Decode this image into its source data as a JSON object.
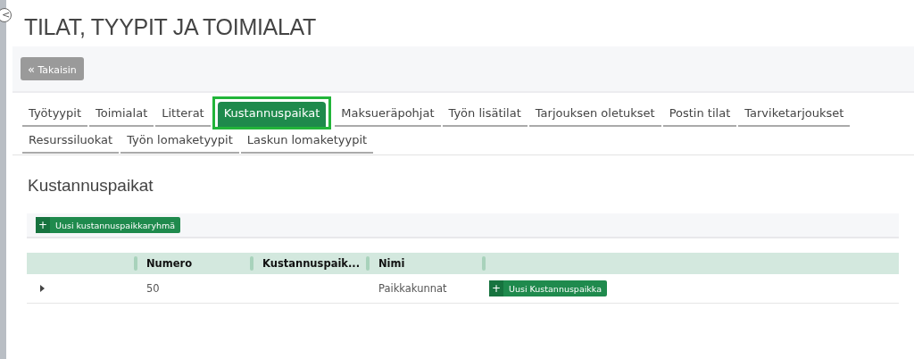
{
  "page": {
    "title": "TILAT, TYYPIT JA TOIMIALAT",
    "collapse_icon": "<"
  },
  "back_button": {
    "icon": "«",
    "label": "Takaisin"
  },
  "tab_rows": [
    [
      {
        "label": "Työtyypit",
        "selected": false
      },
      {
        "label": "Toimialat",
        "selected": false
      },
      {
        "label": "Litterat",
        "selected": false
      },
      {
        "label": "Kustannuspaikat",
        "selected": true,
        "highlighted": true
      },
      {
        "label": "Maksueräpohjat",
        "selected": false
      },
      {
        "label": "Työn lisätilat",
        "selected": false
      },
      {
        "label": "Tarjouksen oletukset",
        "selected": false
      },
      {
        "label": "Postin tilat",
        "selected": false
      },
      {
        "label": "Tarviketarjoukset",
        "selected": false
      }
    ],
    [
      {
        "label": "Resurssiluokat",
        "selected": false
      },
      {
        "label": "Työn lomaketyypit",
        "selected": false
      },
      {
        "label": "Laskun lomaketyypit",
        "selected": false
      }
    ]
  ],
  "section": {
    "title": "Kustannuspaikat",
    "add_group_button": {
      "icon": "+",
      "label": "Uusi kustannuspaikkaryhmä"
    }
  },
  "table": {
    "columns": [
      "Numero",
      "Kustannuspaik...",
      "Nimi"
    ],
    "rows": [
      {
        "expanded": false,
        "cells": [
          "50",
          "",
          "Paikkakunnat"
        ],
        "action": {
          "icon": "+",
          "label": "Uusi Kustannuspaikka"
        }
      }
    ]
  }
}
